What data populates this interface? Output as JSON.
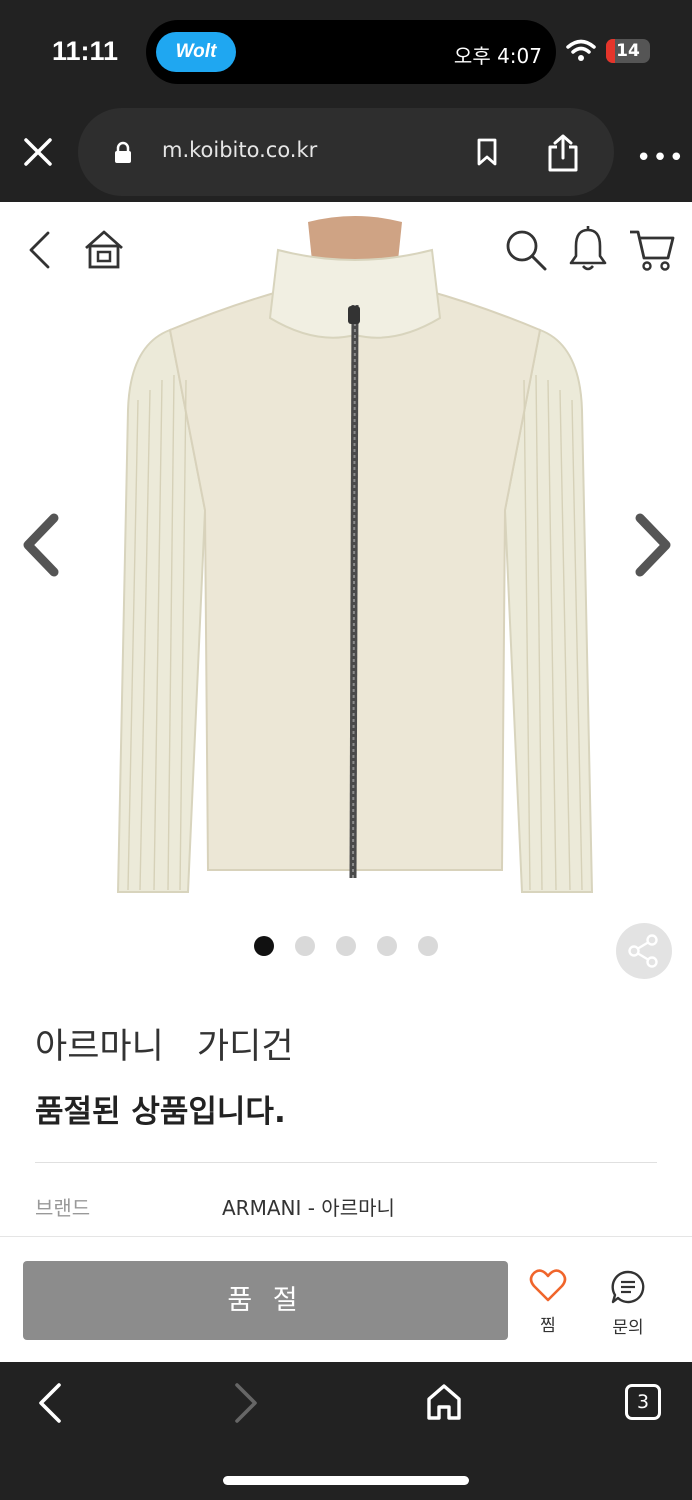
{
  "status_bar": {
    "time": "11:11",
    "live_activity_app": "Wolt",
    "live_activity_time": "오후 4:07",
    "battery": "14",
    "icons": [
      "wifi-icon",
      "battery-icon"
    ]
  },
  "browser": {
    "url": "m.koibito.co.kr",
    "icons": [
      "close-icon",
      "lock-icon",
      "bookmark-icon",
      "share-icon",
      "more-icon"
    ],
    "tab_count": "3"
  },
  "site_header": {
    "icons": [
      "back-icon",
      "home-icon",
      "search-icon",
      "bell-icon",
      "cart-icon"
    ]
  },
  "gallery": {
    "image_description": "Armani cream cardigan: suede front panel with zip, ribbed knit sleeves and collar",
    "total_images": 5,
    "active_index": 0
  },
  "product": {
    "name": "아르마니 가디건",
    "status_message": "품절된 상품입니다.",
    "brand_label": "브랜드",
    "brand_value": "ARMANI - 아르마니"
  },
  "actions": {
    "soldout_button": "품 절",
    "wishlist_label": "찜",
    "inquiry_label": "문의"
  },
  "colors": {
    "wishlist_heart": "#f0652b",
    "soldout_button_bg": "#8c8c8c",
    "chrome_bg": "#222222",
    "wolt_blue": "#1fa7f1",
    "battery_red": "#e5352b"
  }
}
